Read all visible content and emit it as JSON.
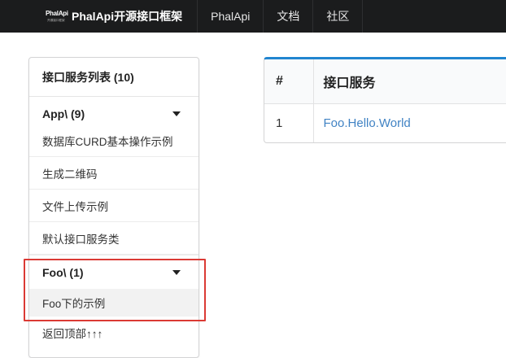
{
  "nav": {
    "logo_text": "PhalApi",
    "logo_sub": "开源接口框架",
    "brand_title": "PhalApi开源接口框架",
    "items": [
      "PhalApi",
      "文档",
      "社区"
    ]
  },
  "sidebar": {
    "header": "接口服务列表 (10)",
    "groups": [
      {
        "title": "App\\ (9)",
        "items": [
          "数据库CURD基本操作示例",
          "生成二维码",
          "文件上传示例",
          "默认接口服务类"
        ]
      },
      {
        "title": "Foo\\ (1)",
        "items": [
          "Foo下的示例"
        ]
      }
    ],
    "back_to_top": "返回顶部↑↑↑"
  },
  "table": {
    "headers": [
      "#",
      "接口服务"
    ],
    "rows": [
      {
        "num": "1",
        "service": "Foo.Hello.World"
      }
    ]
  },
  "colors": {
    "topbar": "#1b1c1d",
    "accent": "#2185d0",
    "link": "#4183c4",
    "highlight": "#db3a34"
  }
}
